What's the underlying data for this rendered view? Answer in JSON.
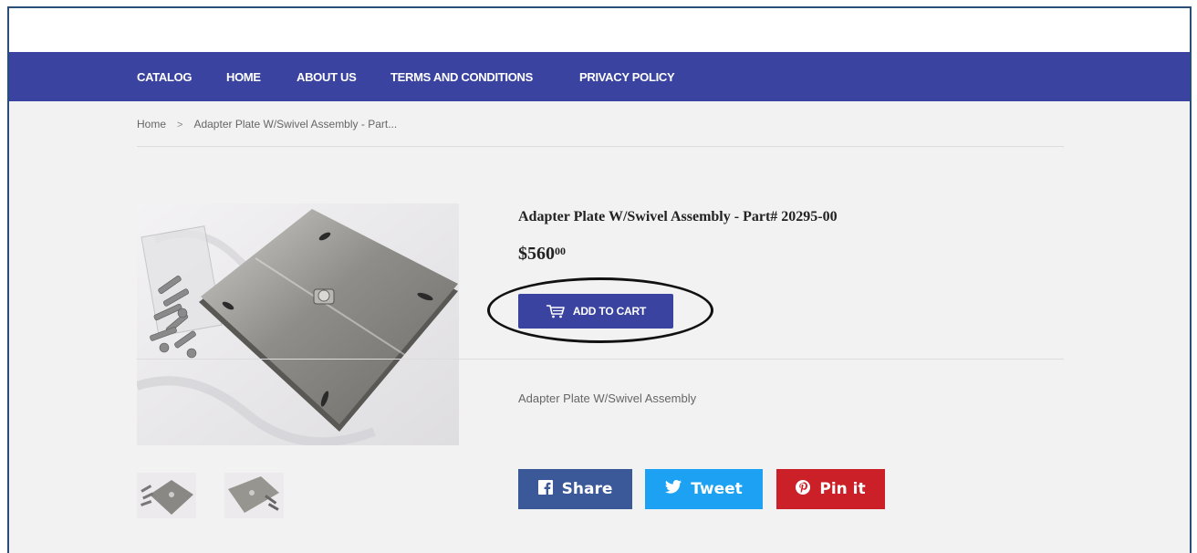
{
  "nav": {
    "items": [
      "CATALOG",
      "HOME",
      "ABOUT US",
      "TERMS AND CONDITIONS",
      "PRIVACY POLICY"
    ]
  },
  "breadcrumb": {
    "home": "Home",
    "separator": ">",
    "current": "Adapter Plate W/Swivel Assembly - Part..."
  },
  "product": {
    "title": "Adapter Plate W/Swivel Assembly - Part# 20295-00",
    "price_whole": "$560",
    "price_cents": "00",
    "add_to_cart": "ADD TO CART",
    "description": "Adapter Plate W/Swivel Assembly"
  },
  "social": {
    "share": "Share",
    "tweet": "Tweet",
    "pin": "Pin it"
  },
  "icons": {
    "cart": "cart-icon",
    "facebook": "facebook-icon",
    "twitter": "twitter-icon",
    "pinterest": "pinterest-icon"
  },
  "colors": {
    "nav_bg": "#3a44a0",
    "button_bg": "#3a44a0",
    "facebook": "#3b5998",
    "twitter": "#1da1f2",
    "pinterest": "#cb2027",
    "page_bg": "#f2f2f2"
  }
}
